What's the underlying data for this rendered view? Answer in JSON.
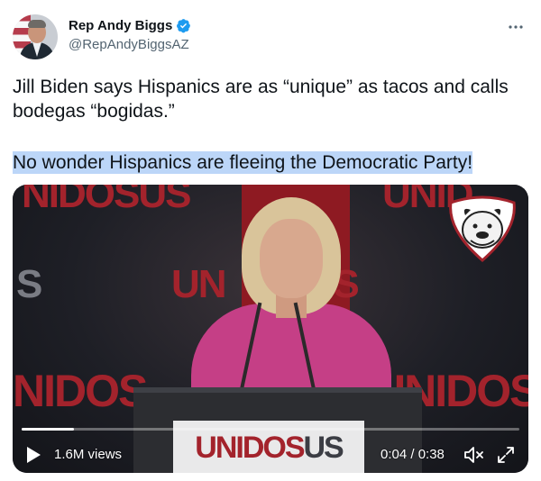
{
  "author": {
    "display_name": "Rep Andy Biggs",
    "handle": "@RepAndyBiggsAZ",
    "verified": true
  },
  "tweet": {
    "text": "Jill Biden says Hispanics are as “unique” as tacos and calls bodegas “bogidas.”",
    "highlighted_text": "No wonder Hispanics are fleeing the Democratic Party!"
  },
  "video": {
    "views": "1.6M views",
    "time": "0:04 / 0:38",
    "progress": 0.105,
    "podium_sign": {
      "part1": "UNIDOS",
      "part2": "US"
    },
    "colors": {
      "brand_red": "#a3232c",
      "dress": "#c53f86"
    }
  },
  "icons": {
    "verified": "verified-badge-icon",
    "more": "more-options-icon",
    "play": "play-icon",
    "mute": "muted-speaker-icon",
    "fullscreen": "fullscreen-icon",
    "watermark": "bulldog-logo-icon"
  },
  "colors": {
    "verified_blue": "#1d9bf0",
    "highlight": "#bcd6f8",
    "secondary_text": "#536471"
  }
}
